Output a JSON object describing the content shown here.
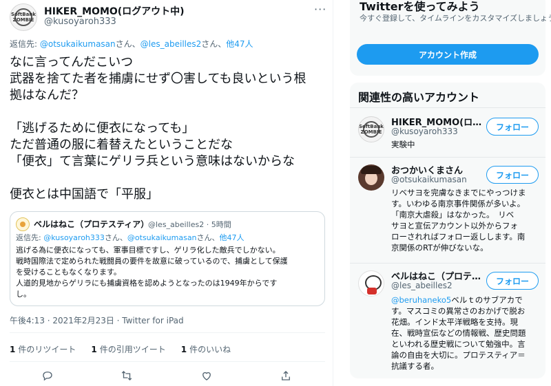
{
  "tweet": {
    "author_name": "HIKER_MOMO(ログアウト中)",
    "author_handle": "@kusoyaroh333",
    "avatar_text": "SoftBank ZOMBIE",
    "reply_prefix": "返信先: ",
    "reply_user1": "@otsukaikumasan",
    "reply_sep": "さん、",
    "reply_user2": "@les_abeilles2",
    "reply_sep2": "さん、",
    "reply_others": "他47人",
    "body": {
      "l1": "なに言ってんだこいつ",
      "l2": "武器を捨てた者を捕虜にせず〇害しても良いという根",
      "l3": "拠はなんだ？",
      "l4": "「逃げるために便衣になっても」",
      "l5": "ただ普通の服に着替えたということだな",
      "l6": "「便衣」て言葉にゲリラ兵という意味はないからな",
      "l7": "便衣とは中国語で「平服」"
    },
    "timestamp": "午後4:13 · 2021年2月23日 · Twitter for iPad"
  },
  "quote": {
    "name": "ベルはねこ（プロテスティア）",
    "meta": "@les_abeilles2 · 5時間",
    "reply_prefix": "返信先: ",
    "reply_user1": "@kusoyaroh333",
    "reply_sep": "さん、",
    "reply_user2": "@otsukaikumasan",
    "reply_sep2": "さん、",
    "reply_others": "他47人",
    "text": {
      "l1": "逃げる為に便衣になっても、軍事目標ですし、ゲリラ化した敵兵でしかない。",
      "l2": "戦時国際法で定められた戦闘員の要件を故意に破っているので、捕虜として保護",
      "l3": "を受けることもなくなります。",
      "l4": "人道的見地からゲリラにも捕虜資格を認めようとなったのは1949年からです",
      "l5": "し。"
    }
  },
  "stats": {
    "retweets_count": "1",
    "retweets_label": "件のリツイート",
    "quotes_count": "1",
    "quotes_label": "件の引用ツイート",
    "likes_count": "1",
    "likes_label": "件のいいね"
  },
  "actions": [
    "reply-icon",
    "retweet-icon",
    "like-icon",
    "share-icon"
  ],
  "sidebar": {
    "signup_title": "Twitterを使ってみよう",
    "signup_sub": "今すぐ登録して、タイムラインをカスタマイズしましょう。",
    "signup_button": "アカウント作成",
    "related_title": "関連性の高いアカウント",
    "follow_label": "フォロー",
    "accounts": [
      {
        "name": "HIKER_MOMO(ロ…",
        "handle": "@kusoyaroh333",
        "bio": [
          "実験中"
        ]
      },
      {
        "name": "おつかいくまさん",
        "handle": "@otsukaikumasan",
        "bio": [
          "リベサヨを完膚なきまでにやっつけま",
          "す。いわゆる南京事件関係が多いよ。",
          "「南京大虐殺」はなかった。　リベ",
          "サヨと宣伝アカウント以外からフォ",
          "ローされればフォロー返しします。南",
          "京関係のRTが伸びないな。"
        ]
      },
      {
        "name": "ベルはねこ（プロテ…",
        "handle": "@les_abeilles2",
        "bio_link": "@beruhaneko5",
        "bio": [
          "ベルｔのサブアカで",
          "す。マスコミの異常さのおかげで脱お",
          "花畑。インド太平洋戦略を支持。現",
          "在、戦時宣伝などの情報戦、歴史問題",
          "といわれる歴史戦について勉強中。言",
          "論の自由を大切に。プロテスティア＝",
          "抗議する者。"
        ]
      }
    ]
  },
  "colors": {
    "accent": "#1d9bf0",
    "text": "#0f1419",
    "muted": "#536471",
    "border": "#cfd9de"
  }
}
